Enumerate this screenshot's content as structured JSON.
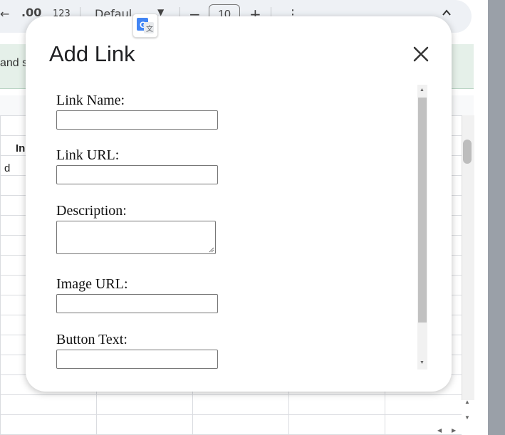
{
  "toolbar": {
    "decimal_increase": ".00",
    "number_format": "123",
    "font_family": "Defaul",
    "decrease": "−",
    "font_size": "10",
    "increase": "+",
    "more": "⋮",
    "collapse": "⌃"
  },
  "banner": {
    "text": "and s"
  },
  "sheet": {
    "header_cell": "In",
    "cell_a1": "d"
  },
  "dialog": {
    "title": "Add Link",
    "fields": {
      "link_name_label": "Link Name:",
      "link_url_label": "Link URL:",
      "description_label": "Description:",
      "image_url_label": "Image URL:",
      "button_text_label": "Button Text:"
    },
    "values": {
      "link_name": "",
      "link_url": "",
      "description": "",
      "image_url": "",
      "button_text": ""
    }
  },
  "icons": {
    "close": "close-icon",
    "translate": "google-translate-icon"
  }
}
